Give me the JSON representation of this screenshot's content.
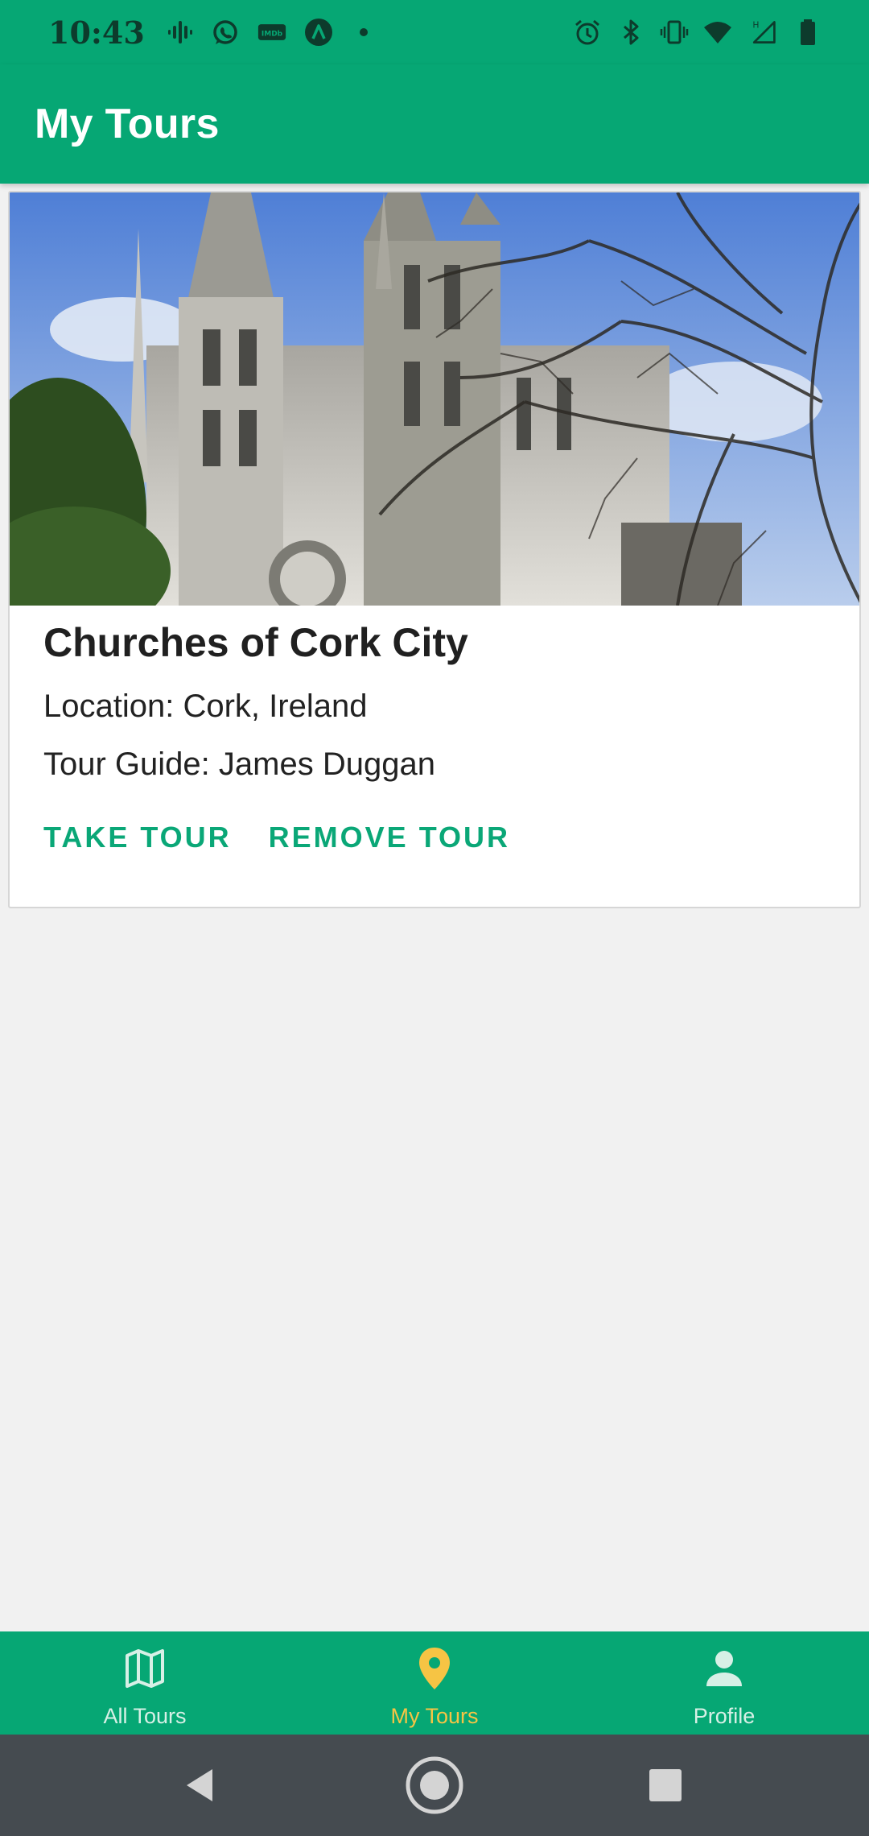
{
  "status_bar": {
    "time": "10:43",
    "left_icons": [
      "podcast-icon",
      "whatsapp-icon",
      "imdb-icon",
      "app-a-icon",
      "dot-icon"
    ],
    "imdb_text": "IMDb",
    "network_label": "H",
    "right_icons": [
      "alarm-icon",
      "bluetooth-icon",
      "vibrate-icon",
      "wifi-icon",
      "signal-icon",
      "battery-icon"
    ]
  },
  "app_bar": {
    "title": "My Tours"
  },
  "tour_card": {
    "title": "Churches of Cork City",
    "location": "Location: Cork, Ireland",
    "guide": "Tour Guide: James Duggan",
    "take_label": "TAKE TOUR",
    "remove_label": "REMOVE TOUR"
  },
  "bottom_nav": {
    "items": [
      {
        "label": "All Tours",
        "icon": "map-icon",
        "active": false
      },
      {
        "label": "My Tours",
        "icon": "location-pin-icon",
        "active": true
      },
      {
        "label": "Profile",
        "icon": "person-icon",
        "active": false
      }
    ],
    "active_color": "#f6c444",
    "inactive_color": "#d7f0e6"
  },
  "colors": {
    "primary": "#06a774",
    "accent_text": "#0aa777",
    "background": "#f1f1f1",
    "system_nav": "#454b50"
  }
}
